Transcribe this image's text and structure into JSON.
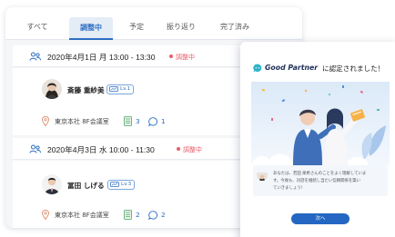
{
  "tabs": [
    {
      "label": "すべて",
      "active": false
    },
    {
      "label": "調整中",
      "active": true
    },
    {
      "label": "予定",
      "active": false
    },
    {
      "label": "振り返り",
      "active": false
    },
    {
      "label": "完了済み",
      "active": false
    }
  ],
  "meetings": [
    {
      "datetime": "2020年4月1日 月 13:00 - 13:30",
      "status": "調整中",
      "person": "斎藤 重紗美",
      "level": "Lv.1",
      "room": "東京本社 8F会議室",
      "doc_count": "3",
      "comment_count": "1"
    },
    {
      "datetime": "2020年4月3日 水 10:00 - 11:30",
      "status": "調整中",
      "person": "冨田 しげる",
      "level": "Lv.3",
      "room": "東京本社 8F会議室",
      "doc_count": "2",
      "comment_count": "2"
    }
  ],
  "modal": {
    "brand": "Good Partner",
    "title_suffix": "に認定されました！",
    "message_lines": [
      "あなたは、若田 楽希さんのことをよく理解していま",
      "す。今後も、対話を継続し当たい信頼関係を築い",
      "ていきましょう！"
    ],
    "next_label": "次へ"
  },
  "colors": {
    "accent": "#2c6ec2",
    "status": "#e85d6a",
    "button": "#2367c2"
  }
}
